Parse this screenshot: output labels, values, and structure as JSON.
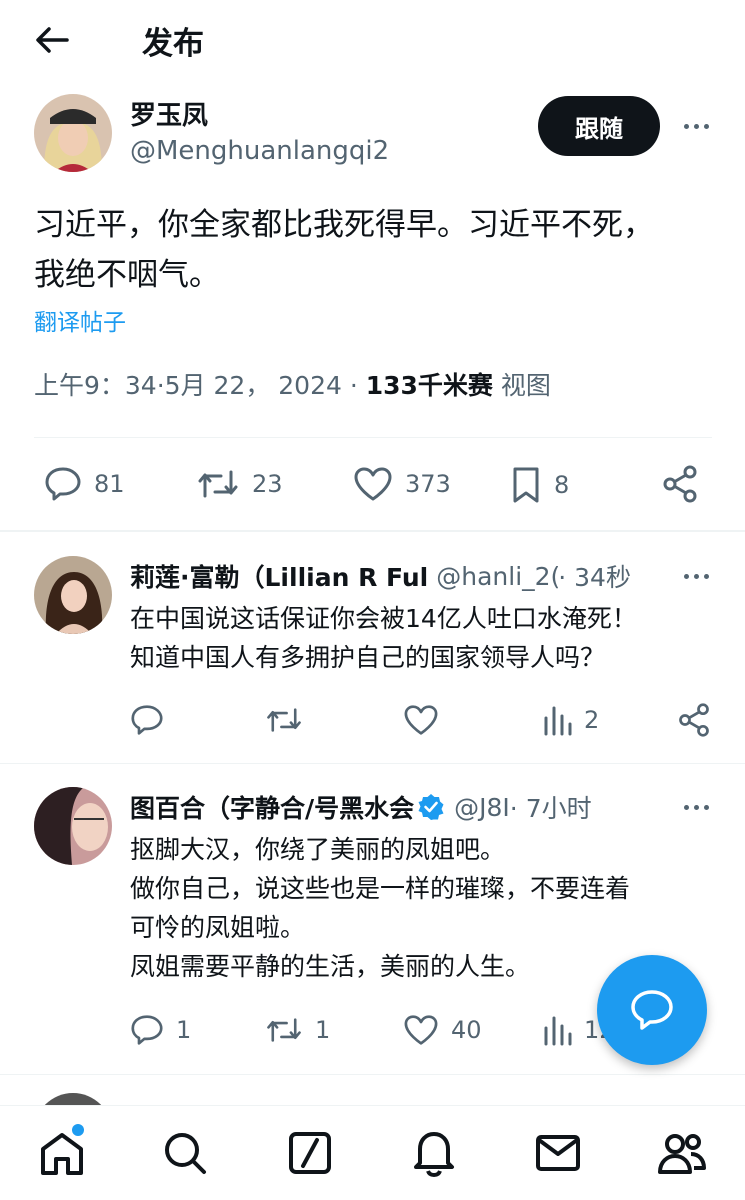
{
  "header": {
    "title": "发布"
  },
  "main_post": {
    "name": "罗玉凤",
    "handle": "@Menghuanlangqi2",
    "follow_label": "跟随",
    "text_line1": "习近平，你全家都比我死得早。习近平不死，",
    "text_line2": "我绝不咽气。",
    "translate_label": "翻译帖子",
    "time": "上午9：34·5月 22， 2024 · ",
    "views_count": "133千米赛",
    "views_label": " 视图",
    "actions": {
      "replies": "81",
      "reposts": "23",
      "likes": "373",
      "bookmarks": "8"
    }
  },
  "replies": [
    {
      "name": "莉莲·富勒（Lillian R Ful",
      "handle": "@hanli_2(",
      "time": " · 34秒",
      "line1": "在中国说这话保证你会被14亿人吐口水淹死！",
      "line2": "知道中国人有多拥护自己的国家领导人吗？",
      "actions": {
        "views": "2"
      }
    },
    {
      "name": "图百合（字静合/号黑水会",
      "handle": "@J8I",
      "time": " · 7小时",
      "line1": "抠脚大汉，你绕了美丽的凤姐吧。",
      "line2": "做你自己，说这些也是一样的璀璨，不要连着",
      "line3": "可怜的凤姐啦。",
      "line4": "凤姐需要平静的生活，美丽的人生。",
      "actions": {
        "replies": "1",
        "reposts": "1",
        "likes": "40",
        "views": "12"
      }
    }
  ],
  "colors": {
    "accent": "#1d9bf0",
    "text": "#0f1419",
    "muted": "#536471"
  },
  "icons": [
    "back-arrow-icon",
    "more-icon",
    "reply-icon",
    "repost-icon",
    "like-icon",
    "bookmark-icon",
    "share-icon",
    "views-icon",
    "verified-icon",
    "compose-icon",
    "home-icon",
    "search-icon",
    "grok-icon",
    "notifications-icon",
    "messages-icon",
    "communities-icon"
  ]
}
